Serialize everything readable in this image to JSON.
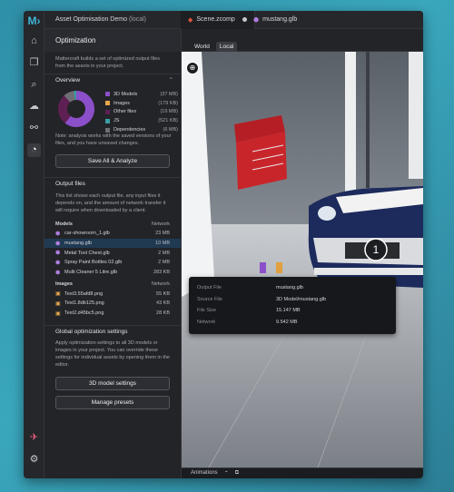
{
  "titlebar": {
    "project_name": "Asset Optimisation Demo",
    "project_scope": "(local)",
    "tabs": [
      {
        "label": "Scene.zcomp",
        "modified": true
      },
      {
        "label": "mustang.glb",
        "modified": false
      }
    ]
  },
  "panel": {
    "title": "Optimization",
    "description": "Mattercraft builds a set of optimized output files from the assets in your project.",
    "overview": {
      "title": "Overview",
      "legend": [
        {
          "label": "3D Models",
          "size": "(37 MB)",
          "color": "#8a4fc9"
        },
        {
          "label": "Images",
          "size": "(179 KB)",
          "color": "#e8a84c"
        },
        {
          "label": "Other files",
          "size": "(19 MB)",
          "color": "#5e1f52"
        },
        {
          "label": "JS",
          "size": "(521 KB)",
          "color": "#3aa0a9"
        },
        {
          "label": "Dependencies",
          "size": "(6 MB)",
          "color": "#6e6f75"
        }
      ],
      "note": "Note: analysis works with the saved versions of your files, and you have unsaved changes.",
      "save_button": "Save All & Analyze"
    },
    "output_files": {
      "title": "Output files",
      "description": "This list shows each output file, any input files it depends on, and the amount of network transfer it will require when downloaded by a client.",
      "models_header": "Models",
      "network_header": "Network",
      "models": [
        {
          "name": "car-showroom_1.glb",
          "size": "23 MB",
          "selected": false
        },
        {
          "name": "mustang.glb",
          "size": "10 MB",
          "selected": true
        },
        {
          "name": "Metal Tool Chest.glb",
          "size": "2 MB",
          "selected": false
        },
        {
          "name": "Spray Paint Bottles 02.glb",
          "size": "2 MB",
          "selected": false
        },
        {
          "name": "Multi Cleaner 5 Litre.glb",
          "size": "283 KB",
          "selected": false
        }
      ],
      "images_header": "Images",
      "images": [
        {
          "name": "Text3.55afd8.png",
          "size": "55 KB"
        },
        {
          "name": "Text1.8db125.png",
          "size": "43 KB"
        },
        {
          "name": "Text2.d45bc5.png",
          "size": "28 KB"
        }
      ]
    },
    "global": {
      "title": "Global optimization settings",
      "description": "Apply optimization settings to all 3D models or images in your project. You can override these settings for individual assets by opening them in the editor.",
      "models_button": "3D model settings",
      "presets_button": "Manage presets"
    }
  },
  "viewport": {
    "toggle_world": "World",
    "toggle_local": "Local",
    "annotation_number": "1",
    "info": {
      "output_file_label": "Output File",
      "output_file": "mustang.glb",
      "source_file_label": "Source File",
      "source_file": "3D Model/mustang.glb",
      "file_size_label": "File Size",
      "file_size": "15.147 MB",
      "network_label": "Network",
      "network": "9.542 MB"
    },
    "animations_label": "Animations"
  }
}
